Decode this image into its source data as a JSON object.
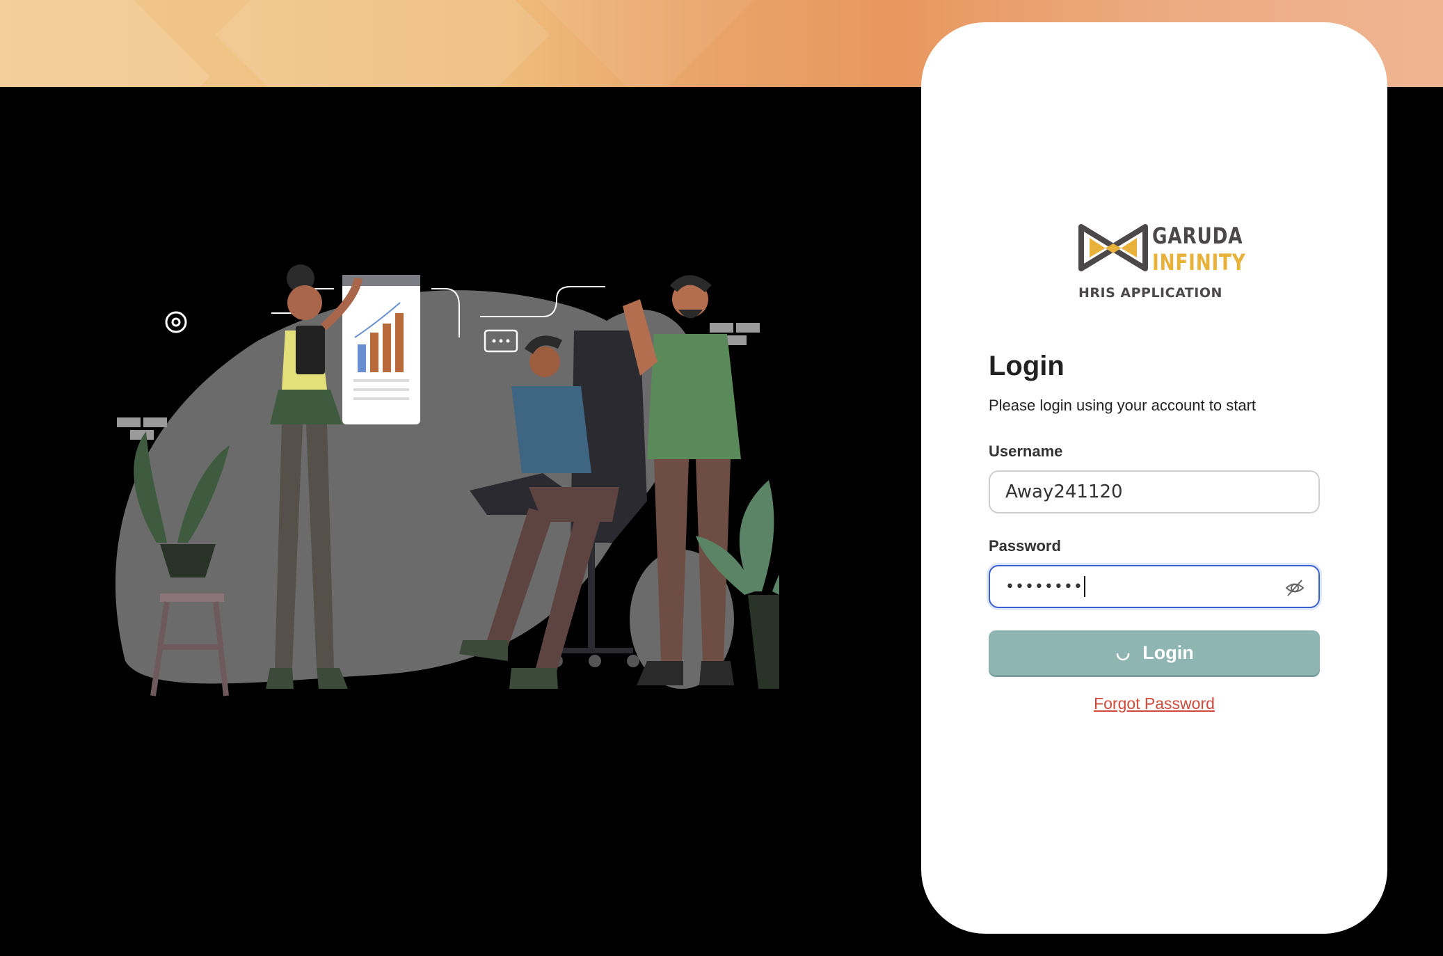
{
  "brand": {
    "name_line1": "GARUDA",
    "name_line2": "INFINITY",
    "tagline": "HRIS APPLICATION",
    "colors": {
      "dark": "#4a4848",
      "gold": "#e8b23a"
    }
  },
  "login": {
    "title": "Login",
    "subtitle": "Please login using your account to start",
    "username_label": "Username",
    "username_value": "Away241120",
    "password_label": "Password",
    "password_masked": "••••••••",
    "button_label": "Login",
    "button_state": "loading",
    "forgot_label": "Forgot Password"
  },
  "icons": {
    "password_toggle": "eye-slash-icon",
    "button_spinner": "spinner-icon",
    "illustration": "team-collaboration-illustration"
  },
  "colors": {
    "accent_button": "#8fb5b2",
    "link_red": "#d04a3b",
    "focus_blue": "#3a5fd0"
  }
}
